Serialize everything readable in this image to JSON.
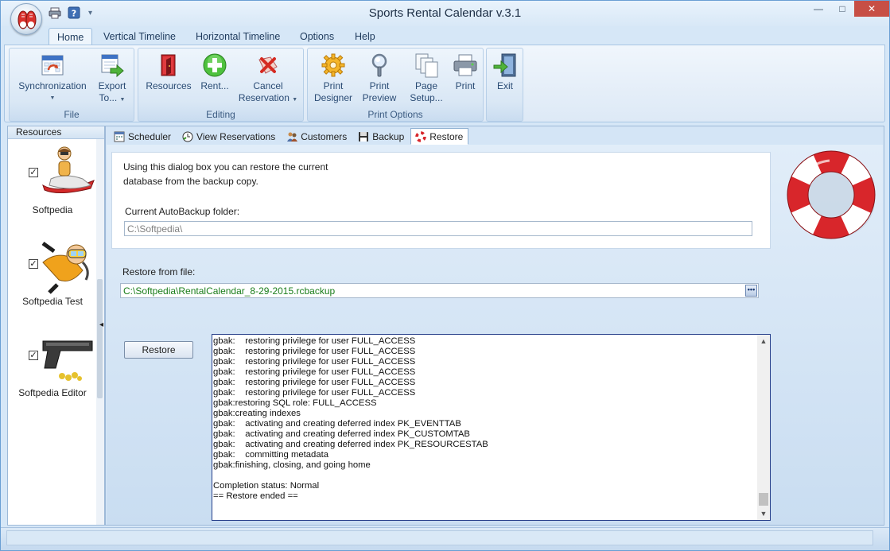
{
  "window": {
    "title": "Sports Rental Calendar v.3.1",
    "controls": {
      "minimize": "—",
      "maximize": "□",
      "close": "✕"
    },
    "qat_dropdown": "▾"
  },
  "ribbon_tabs": [
    "Home",
    "Vertical Timeline",
    "Horizontal Timeline",
    "Options",
    "Help"
  ],
  "ribbon": {
    "file_group": {
      "label": "File",
      "synchronization": "Synchronization",
      "export_line1": "Export",
      "export_line2": "To...",
      "dropdown": "▼"
    },
    "editing_group": {
      "label": "Editing",
      "resources": "Resources",
      "rent": "Rent...",
      "cancel_line1": "Cancel",
      "cancel_line2": "Reservation",
      "dropdown": "▼"
    },
    "print_group": {
      "label": "Print Options",
      "print_designer_line1": "Print",
      "print_designer_line2": "Designer",
      "print_preview_line1": "Print",
      "print_preview_line2": "Preview",
      "page_setup_line1": "Page",
      "page_setup_line2": "Setup...",
      "print": "Print"
    },
    "exit": "Exit"
  },
  "resources": {
    "header": "Resources",
    "collapse_arrow": "◂",
    "items": [
      {
        "name": "Softpedia",
        "checked": "✓"
      },
      {
        "name": "Softpedia Test",
        "checked": "✓"
      },
      {
        "name": "Softpedia Editor",
        "checked": "✓"
      }
    ]
  },
  "doc_tabs": [
    "Scheduler",
    "View Reservations",
    "Customers",
    "Backup",
    "Restore"
  ],
  "restore": {
    "info_line1": "Using this dialog box you can restore the current",
    "info_line2": "database from the backup copy.",
    "auto_backup_label": "Current AutoBackup folder:",
    "auto_backup_value": "C:\\Softpedia\\",
    "restore_from_label": "Restore from file:",
    "restore_from_value": "C:\\Softpedia\\RentalCalendar_8-29-2015.rcbackup",
    "ellipsis": "•••",
    "restore_button": "Restore",
    "scroll_up": "▲",
    "scroll_down": "▼",
    "log_lines": [
      "gbak:    restoring privilege for user FULL_ACCESS",
      "gbak:    restoring privilege for user FULL_ACCESS",
      "gbak:    restoring privilege for user FULL_ACCESS",
      "gbak:    restoring privilege for user FULL_ACCESS",
      "gbak:    restoring privilege for user FULL_ACCESS",
      "gbak:    restoring privilege for user FULL_ACCESS",
      "gbak:restoring SQL role: FULL_ACCESS",
      "gbak:creating indexes",
      "gbak:    activating and creating deferred index PK_EVENTTAB",
      "gbak:    activating and creating deferred index PK_CUSTOMTAB",
      "gbak:    activating and creating deferred index PK_RESOURCESTAB",
      "gbak:    committing metadata",
      "gbak:finishing, closing, and going home",
      "",
      "Completion status: Normal",
      "== Restore ended =="
    ]
  },
  "colors": {
    "accent": "#2a4b74",
    "file_path_green": "#1a7d1a",
    "close_button": "#c74f45",
    "lifebuoy_red": "#d8262b"
  }
}
